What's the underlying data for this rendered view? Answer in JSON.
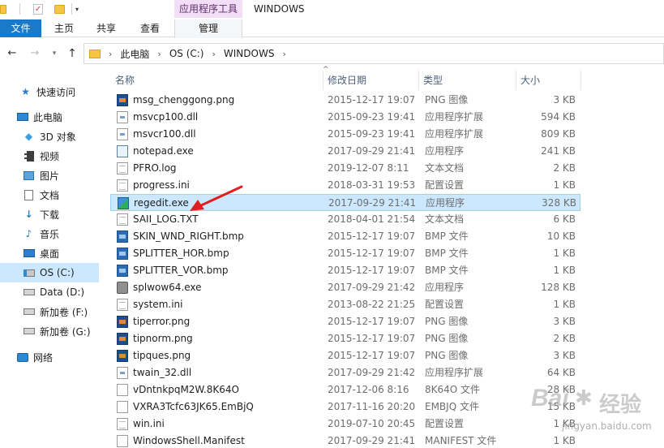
{
  "titlebar": {
    "context_tab": "应用程序工具",
    "window_title": "WINDOWS"
  },
  "ribbon": {
    "tabs": [
      "文件",
      "主页",
      "共享",
      "查看",
      "管理"
    ]
  },
  "address": {
    "crumbs": [
      "此电脑",
      "OS (C:)",
      "WINDOWS"
    ]
  },
  "sidebar": {
    "items": [
      {
        "label": "快速访问",
        "icon": "star-icon"
      },
      {
        "label": "此电脑",
        "icon": "computer-icon"
      },
      {
        "label": "3D 对象",
        "icon": "cube-icon"
      },
      {
        "label": "视频",
        "icon": "video-icon"
      },
      {
        "label": "图片",
        "icon": "image-icon"
      },
      {
        "label": "文档",
        "icon": "document-icon"
      },
      {
        "label": "下载",
        "icon": "download-icon"
      },
      {
        "label": "音乐",
        "icon": "music-icon"
      },
      {
        "label": "桌面",
        "icon": "desktop-icon"
      },
      {
        "label": "OS (C:)",
        "icon": "drive-icon"
      },
      {
        "label": "Data (D:)",
        "icon": "drive-icon"
      },
      {
        "label": "新加卷 (F:)",
        "icon": "drive-icon"
      },
      {
        "label": "新加卷 (G:)",
        "icon": "drive-icon"
      },
      {
        "label": "网络",
        "icon": "network-icon"
      }
    ]
  },
  "columns": {
    "name": "名称",
    "date": "修改日期",
    "type": "类型",
    "size": "大小"
  },
  "files": [
    {
      "name": "msg_chenggong.png",
      "date": "2015-12-17 19:07",
      "type": "PNG 图像",
      "size": "3 KB",
      "icon": "png"
    },
    {
      "name": "msvcp100.dll",
      "date": "2015-09-23 19:41",
      "type": "应用程序扩展",
      "size": "594 KB",
      "icon": "dll"
    },
    {
      "name": "msvcr100.dll",
      "date": "2015-09-23 19:41",
      "type": "应用程序扩展",
      "size": "809 KB",
      "icon": "dll"
    },
    {
      "name": "notepad.exe",
      "date": "2017-09-29 21:41",
      "type": "应用程序",
      "size": "241 KB",
      "icon": "exe-note"
    },
    {
      "name": "PFRO.log",
      "date": "2019-12-07 8:11",
      "type": "文本文档",
      "size": "2 KB",
      "icon": "txt"
    },
    {
      "name": "progress.ini",
      "date": "2018-03-31 19:53",
      "type": "配置设置",
      "size": "1 KB",
      "icon": "txt"
    },
    {
      "name": "regedit.exe",
      "date": "2017-09-29 21:41",
      "type": "应用程序",
      "size": "328 KB",
      "icon": "exe-reg"
    },
    {
      "name": "SAII_LOG.TXT",
      "date": "2018-04-01 21:54",
      "type": "文本文档",
      "size": "6 KB",
      "icon": "txt"
    },
    {
      "name": "SKIN_WND_RIGHT.bmp",
      "date": "2015-12-17 19:07",
      "type": "BMP 文件",
      "size": "10 KB",
      "icon": "bmp"
    },
    {
      "name": "SPLITTER_HOR.bmp",
      "date": "2015-12-17 19:07",
      "type": "BMP 文件",
      "size": "1 KB",
      "icon": "bmp"
    },
    {
      "name": "SPLITTER_VOR.bmp",
      "date": "2015-12-17 19:07",
      "type": "BMP 文件",
      "size": "1 KB",
      "icon": "bmp"
    },
    {
      "name": "splwow64.exe",
      "date": "2017-09-29 21:42",
      "type": "应用程序",
      "size": "128 KB",
      "icon": "exe-print"
    },
    {
      "name": "system.ini",
      "date": "2013-08-22 21:25",
      "type": "配置设置",
      "size": "1 KB",
      "icon": "txt"
    },
    {
      "name": "tiperror.png",
      "date": "2015-12-17 19:07",
      "type": "PNG 图像",
      "size": "3 KB",
      "icon": "png"
    },
    {
      "name": "tipnorm.png",
      "date": "2015-12-17 19:07",
      "type": "PNG 图像",
      "size": "2 KB",
      "icon": "png"
    },
    {
      "name": "tipques.png",
      "date": "2015-12-17 19:07",
      "type": "PNG 图像",
      "size": "3 KB",
      "icon": "png"
    },
    {
      "name": "twain_32.dll",
      "date": "2017-09-29 21:42",
      "type": "应用程序扩展",
      "size": "64 KB",
      "icon": "dll"
    },
    {
      "name": "vDntnkpqM2W.8K64O",
      "date": "2017-12-06 8:16",
      "type": "8K64O 文件",
      "size": "28 KB",
      "icon": "exe-blank"
    },
    {
      "name": "VXRA3Tcfc63JK65.EmBjQ",
      "date": "2017-11-16 20:20",
      "type": "EMBJQ 文件",
      "size": "15 KB",
      "icon": "exe-blank"
    },
    {
      "name": "win.ini",
      "date": "2019-07-10 20:45",
      "type": "配置设置",
      "size": "1 KB",
      "icon": "txt"
    },
    {
      "name": "WindowsShell.Manifest",
      "date": "2017-09-29 21:41",
      "type": "MANIFEST 文件",
      "size": "1 KB",
      "icon": "exe-blank"
    }
  ],
  "selected_index": 6,
  "watermark": {
    "brand": "Bai",
    "word": "经验",
    "url": "jingyan.baidu.com"
  },
  "colors": {
    "accent": "#1979ca",
    "selection": "#cce8ff",
    "context_tab": "#f3def7",
    "annotation_arrow": "#e02020"
  }
}
